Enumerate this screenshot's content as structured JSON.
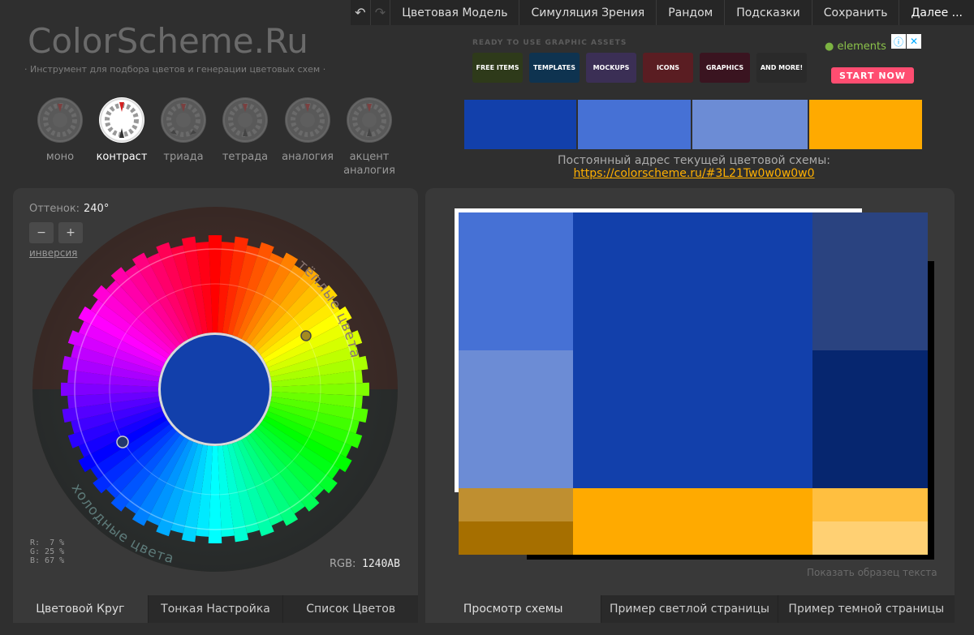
{
  "menu": {
    "undo_icon": "undo-icon",
    "redo_icon": "redo-icon",
    "items": [
      "Цветовая Модель",
      "Симуляция Зрения",
      "Рандом",
      "Подсказки",
      "Сохранить",
      "Далее ..."
    ]
  },
  "logo": "ColorScheme.Ru",
  "tagline": "· Инструмент для подбора цветов и генерации цветовых схем ·",
  "scheme_types": [
    {
      "label": "моно",
      "active": false
    },
    {
      "label": "контраст",
      "active": true
    },
    {
      "label": "триада",
      "active": false
    },
    {
      "label": "тетрада",
      "active": false
    },
    {
      "label": "аналогия",
      "active": false
    },
    {
      "label": "акцент аналогия",
      "active": false
    }
  ],
  "ad": {
    "heading": "READY TO USE GRAPHIC ASSETS",
    "tiles": [
      "FREE ITEMS",
      "TEMPLATES",
      "MOCKUPS",
      "ICONS",
      "GRAPHICS",
      "AND MORE!"
    ],
    "brand": "elements",
    "cta": "START NOW",
    "info_icon": "ⓘ",
    "close_icon": "✕"
  },
  "palette": [
    "#1240ab",
    "#4671d5",
    "#6c8cd5",
    "#ffaa00"
  ],
  "permalink": {
    "label": "Постоянный адрес текущей цветовой схемы:",
    "url": "https://colorscheme.ru/#3L21Tw0w0w0w0"
  },
  "wheel": {
    "hue_label": "Оттенок:",
    "hue_value": "240°",
    "minus": "−",
    "plus": "+",
    "invert": "инверсия",
    "warm_label": "тёплые цвета",
    "cold_label": "холодные цвета",
    "center_color": "#1240ab",
    "rgb_percent": "R:  7 %\nG: 25 %\nB: 67 %",
    "rgb_label": "RGB:",
    "rgb_hex": "1240AB"
  },
  "left_tabs": [
    "Цветовой Круг",
    "Тонкая Настройка",
    "Список Цветов"
  ],
  "right_tabs": [
    "Просмотр схемы",
    "Пример светлой страницы",
    "Пример темной страницы"
  ],
  "preview": {
    "sample_text": "Показать образец текста",
    "colors": {
      "primary": "#1240ab",
      "primary_light": "#4671d5",
      "primary_lighter": "#6c8cd5",
      "primary_dark": "#2a4380",
      "primary_darker": "#06266f",
      "accent": "#ffaa00",
      "accent_muted": "#bf8f30",
      "accent_dark": "#a66f00",
      "accent_light": "#ffbf40",
      "accent_lighter": "#ffd073"
    }
  }
}
